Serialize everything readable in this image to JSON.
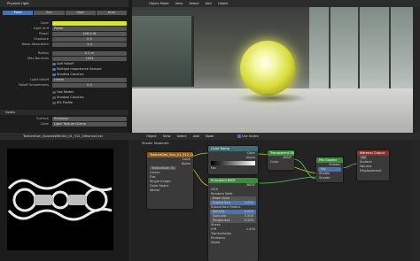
{
  "properties": {
    "object_name": "Physical Light",
    "tabs": [
      "Point",
      "Sun",
      "Spot",
      "Area"
    ],
    "fields": [
      {
        "label": "Color",
        "value": ""
      },
      {
        "label": "Light Unit",
        "value": "Power"
      },
      {
        "label": "Power",
        "value": "256.0 W"
      },
      {
        "label": "Exposure",
        "value": "0.0"
      },
      {
        "label": "Wave Absorption",
        "value": "3.4"
      },
      {
        "label": "Radius",
        "value": "0.1 m"
      },
      {
        "label": "Max Bounces",
        "value": "1024"
      }
    ],
    "checks": [
      "Soft Falloff",
      "Multiple Importance Sample",
      "Shadow Caustics"
    ],
    "falloff_label": "Light Falloff",
    "falloff_value": "Linear",
    "falloff_smoothness_label": "Falloff Smoothness",
    "falloff_smoothness_value": "0.5",
    "extra_checks": [
      "Use Nodes",
      "Shadow Caustics",
      "IES Profile"
    ],
    "section_nodes": "Nodes",
    "surface_label": "Surface",
    "surface_value": "Emission",
    "color_label": "Color",
    "color_value": "Light Texture Gizmo"
  },
  "viewport": {
    "menu": [
      "Object Mode",
      "View",
      "Select",
      "Add",
      "Object"
    ],
    "options_label": "Options"
  },
  "image_editor": {
    "title": "TextureGen_SoundsWithGlo_01_512_2dhorus4.exr",
    "menu": [
      "View",
      "Image"
    ]
  },
  "node_editor": {
    "menu": [
      "Object",
      "View",
      "Select",
      "Add",
      "Node"
    ],
    "use_nodes_label": "Use Nodes",
    "breadcrumb": "Shader Nodetree",
    "nodes": {
      "image_texture": {
        "title": "TextureGen_Sou_01_512_2dhor",
        "rows": [
          "Color",
          "Alpha",
          "Linear",
          "Flat",
          "Single Image",
          "Color Space",
          "Alpha",
          "Vector"
        ],
        "field": "TextureGen 01"
      },
      "color_ramp": {
        "title": "Color Ramp",
        "rows": [
          "Color",
          "Alpha",
          "RGB",
          "Linear",
          "Fac"
        ]
      },
      "principled": {
        "title": "Principled BSDF",
        "rows": [
          "BSDF",
          "GGX",
          "Random Walk",
          "Base Color",
          "Subsurface",
          "Subsurface Radius",
          "Metallic",
          "Specular",
          "Roughness",
          "Sheen",
          "IOR",
          "Transmission",
          "Emission",
          "Alpha",
          "Normal"
        ],
        "values": [
          "",
          "",
          "",
          "",
          "0.000",
          "",
          "0.000",
          "0.500",
          "0.500",
          "0.000",
          "1.450",
          "0.000",
          "",
          "1.000",
          ""
        ]
      },
      "transparent": {
        "title": "Transparent BSDF",
        "rows": [
          "BSDF",
          "Color"
        ]
      },
      "mix_shader": {
        "title": "Mix Shader",
        "rows": [
          "Shader",
          "Fac",
          "Shader",
          "Shader"
        ]
      },
      "material_output": {
        "title": "Material Output",
        "rows": [
          "All",
          "Surface",
          "Volume",
          "Displacement"
        ]
      }
    }
  }
}
